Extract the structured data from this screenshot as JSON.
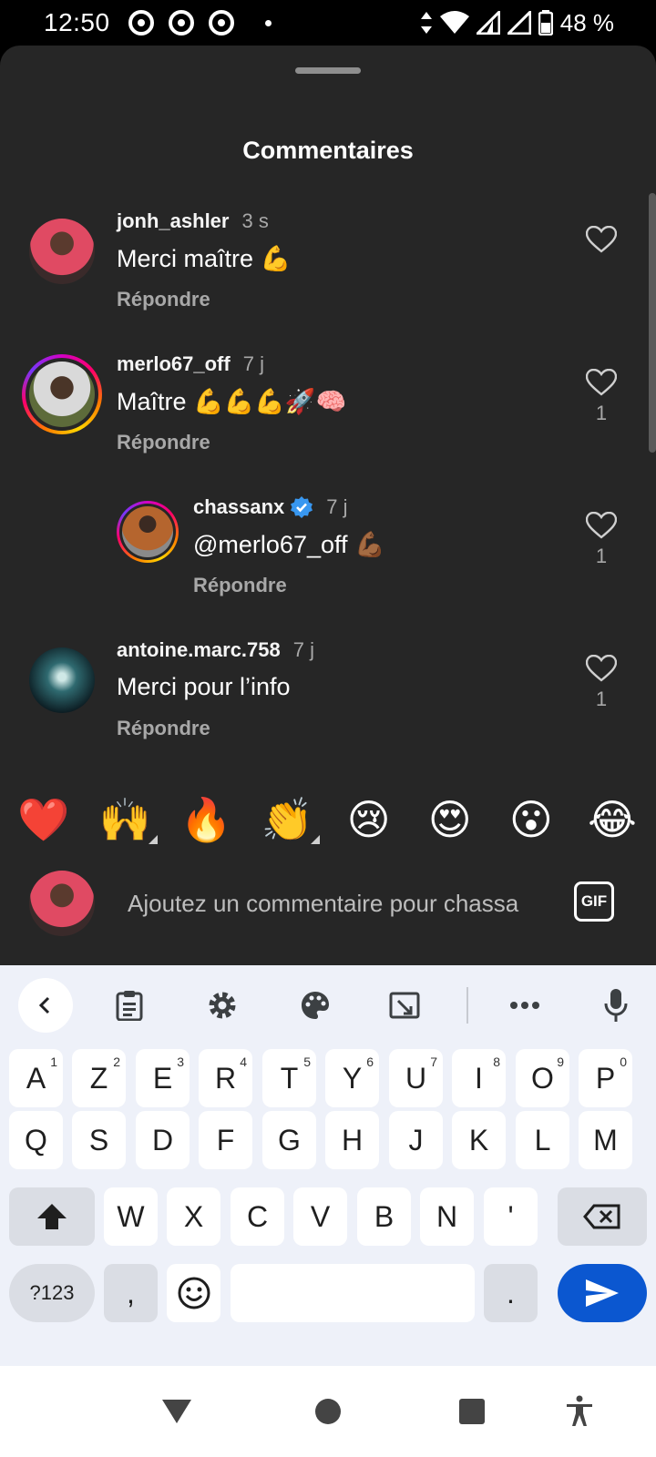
{
  "status_bar": {
    "time": "12:50",
    "battery": "48 %",
    "icons": [
      "chrome-icon",
      "chrome-icon",
      "chrome-icon",
      "notification-dot",
      "data-arrows-icon",
      "wifi-icon",
      "signal-icon",
      "signal-icon",
      "battery-icon"
    ]
  },
  "sheet": {
    "title": "Commentaires"
  },
  "comments": [
    {
      "user": "jonh_ashler",
      "time": "3 s",
      "text": "Merci maître 💪",
      "reply_label": "Répondre",
      "likes": ""
    },
    {
      "user": "merlo67_off",
      "time": "7 j",
      "text": "Maître 💪💪💪🚀🧠",
      "reply_label": "Répondre",
      "likes": "1"
    },
    {
      "user": "chassanx",
      "time": "7 j",
      "text": "@merlo67_off 💪🏾",
      "reply_label": "Répondre",
      "likes": "1",
      "verified": true,
      "is_reply": true
    },
    {
      "user": "antoine.marc.758",
      "time": "7 j",
      "text": "Merci pour l’info",
      "reply_label": "Répondre",
      "likes": "1"
    }
  ],
  "quick_reactions": [
    "❤️",
    "🙌",
    "🔥",
    "👏",
    "😢",
    "😍",
    "😮",
    "😂"
  ],
  "composer": {
    "placeholder": "Ajoutez un commentaire pour chassa",
    "gif_label": "GIF"
  },
  "keyboard": {
    "row1": [
      {
        "k": "A",
        "n": "1"
      },
      {
        "k": "Z",
        "n": "2"
      },
      {
        "k": "E",
        "n": "3"
      },
      {
        "k": "R",
        "n": "4"
      },
      {
        "k": "T",
        "n": "5"
      },
      {
        "k": "Y",
        "n": "6"
      },
      {
        "k": "U",
        "n": "7"
      },
      {
        "k": "I",
        "n": "8"
      },
      {
        "k": "O",
        "n": "9"
      },
      {
        "k": "P",
        "n": "0"
      }
    ],
    "row2": [
      "Q",
      "S",
      "D",
      "F",
      "G",
      "H",
      "J",
      "K",
      "L",
      "M"
    ],
    "row3": [
      "W",
      "X",
      "C",
      "V",
      "B",
      "N",
      "'"
    ],
    "symbols_label": "?123",
    "comma_label": ",",
    "period_label": "."
  },
  "colors": {
    "sheet_bg": "#262626",
    "keyboard_bg": "#eef1f9",
    "send_key": "#0b57d0"
  }
}
